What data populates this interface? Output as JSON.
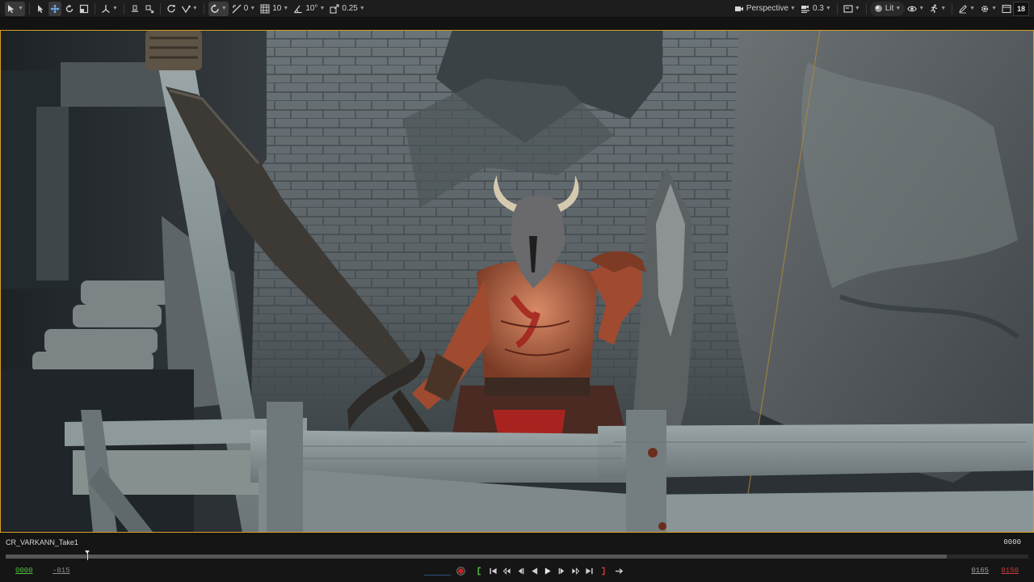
{
  "toolbar": {
    "left": {
      "translate_snap_value": "0",
      "grid_value": "10",
      "rotation_snap_value": "10°",
      "scale_snap_value": "0.25"
    },
    "right": {
      "view_mode_label": "Perspective",
      "camera_speed_value": "0.3",
      "lighting_mode_label": "Lit",
      "screen_percentage_badge": "18"
    }
  },
  "sequencer": {
    "take_name": "CR_VARKANN_Take1",
    "current_frame": "0000",
    "start_frame": "0000",
    "start_offset": "-015",
    "end_frame": "0165",
    "end_out_frame": "0150",
    "playback_progress": 0.92,
    "playhead_position": 0.08
  },
  "colors": {
    "camera_frame_border": "#d6a124",
    "start_frame_green": "#4fbf3f",
    "end_frame_red": "#c93a3a",
    "record_red": "#c0262a"
  }
}
